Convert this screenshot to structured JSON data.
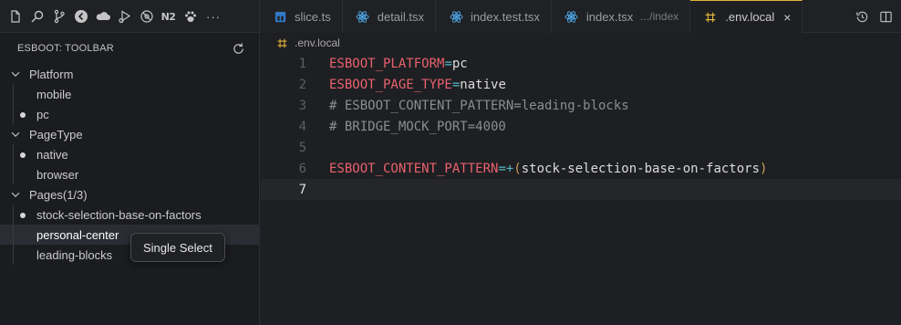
{
  "activity_bar": {
    "items": [
      {
        "icon": "files-icon"
      },
      {
        "icon": "search-icon"
      },
      {
        "icon": "source-control-icon"
      },
      {
        "icon": "timeline-icon"
      },
      {
        "icon": "cloud-icon"
      },
      {
        "icon": "run-debug-icon"
      },
      {
        "icon": "no-bug-icon"
      },
      {
        "icon": "n2-text-icon",
        "text": "N2"
      },
      {
        "icon": "paw-icon"
      }
    ],
    "more_label": "···"
  },
  "tabs": [
    {
      "label": "slice.ts",
      "icon": "typescript-file-icon",
      "description": ""
    },
    {
      "label": "detail.tsx",
      "icon": "react-file-icon",
      "description": ""
    },
    {
      "label": "index.test.tsx",
      "icon": "react-file-icon",
      "description": ""
    },
    {
      "label": "index.tsx",
      "icon": "react-file-icon",
      "description": ".../index"
    },
    {
      "label": ".env.local",
      "icon": "env-file-icon",
      "description": "",
      "active": true,
      "close": "×"
    }
  ],
  "sidebar": {
    "title": "ESBOOT: TOOLBAR",
    "groups": [
      {
        "label": "Platform",
        "items": [
          {
            "label": "mobile",
            "checked": false
          },
          {
            "label": "pc",
            "checked": true
          }
        ]
      },
      {
        "label": "PageType",
        "items": [
          {
            "label": "native",
            "checked": true
          },
          {
            "label": "browser",
            "checked": false
          }
        ]
      },
      {
        "label": "Pages(1/3)",
        "items": [
          {
            "label": "stock-selection-base-on-factors",
            "checked": true
          },
          {
            "label": "personal-center",
            "checked": false,
            "selected": true
          },
          {
            "label": "leading-blocks",
            "checked": false
          }
        ]
      }
    ],
    "tooltip": "Single Select"
  },
  "editor": {
    "breadcrumb": ".env.local",
    "current_line": 7,
    "lines": [
      {
        "n": "1",
        "key": "ESBOOT_PLATFORM",
        "op": "=",
        "val": "pc"
      },
      {
        "n": "2",
        "key": "ESBOOT_PAGE_TYPE",
        "op": "=",
        "val": "native"
      },
      {
        "n": "3",
        "comment": "# ESBOOT_CONTENT_PATTERN=leading-blocks"
      },
      {
        "n": "4",
        "comment": "# BRIDGE_MOCK_PORT=4000"
      },
      {
        "n": "5"
      },
      {
        "n": "6",
        "key": "ESBOOT_CONTENT_PATTERN",
        "op": "=+",
        "paren_open": "(",
        "val": "stock-selection-base-on-factors",
        "paren_close": ")"
      },
      {
        "n": "7"
      }
    ]
  },
  "colors": {
    "accent": "#e0b43b",
    "env_key": "#e8626f",
    "operator": "#56b6c2",
    "comment": "#8a8d92"
  }
}
